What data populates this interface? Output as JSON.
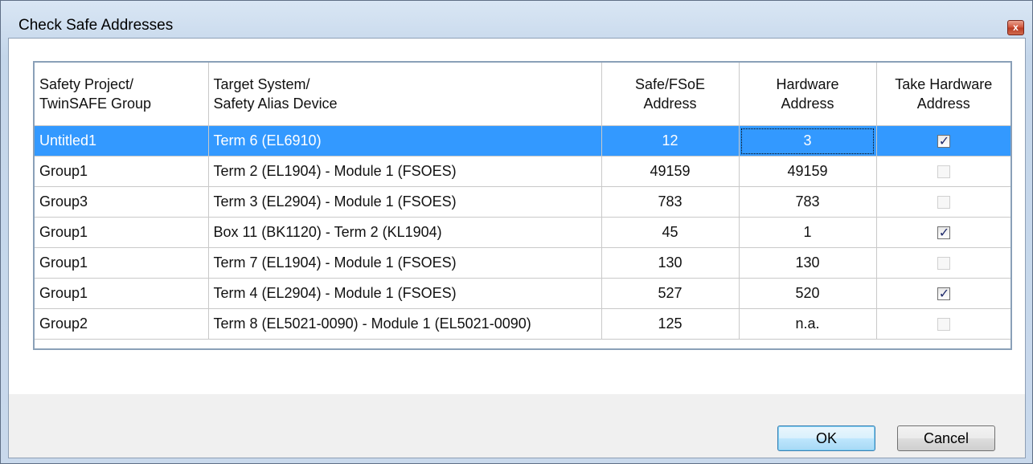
{
  "window": {
    "title": "Check Safe Addresses",
    "close_glyph": "x"
  },
  "grid": {
    "columns": [
      {
        "line1": "Safety Project/",
        "line2": "TwinSAFE Group"
      },
      {
        "line1": "Target System/",
        "line2": "Safety Alias Device"
      },
      {
        "line1": "Safe/FSoE",
        "line2": "Address"
      },
      {
        "line1": "Hardware",
        "line2": "Address"
      },
      {
        "line1": "Take Hardware",
        "line2": "Address"
      }
    ],
    "rows": [
      {
        "group": "Untitled1",
        "target": "Term 6 (EL6910)",
        "safe_address": "12",
        "hardware_address": "3",
        "take_hardware": true,
        "enabled": true,
        "selected": true
      },
      {
        "group": "Group1",
        "target": "Term 2 (EL1904) - Module 1 (FSOES)",
        "safe_address": "49159",
        "hardware_address": "49159",
        "take_hardware": false,
        "enabled": false,
        "selected": false
      },
      {
        "group": "Group3",
        "target": "Term 3 (EL2904) - Module 1 (FSOES)",
        "safe_address": "783",
        "hardware_address": "783",
        "take_hardware": false,
        "enabled": false,
        "selected": false
      },
      {
        "group": "Group1",
        "target": "Box 11 (BK1120) - Term 2 (KL1904)",
        "safe_address": "45",
        "hardware_address": "1",
        "take_hardware": true,
        "enabled": true,
        "selected": false
      },
      {
        "group": "Group1",
        "target": "Term 7 (EL1904) - Module 1 (FSOES)",
        "safe_address": "130",
        "hardware_address": "130",
        "take_hardware": false,
        "enabled": false,
        "selected": false
      },
      {
        "group": "Group1",
        "target": "Term 4 (EL2904) - Module 1 (FSOES)",
        "safe_address": "527",
        "hardware_address": "520",
        "take_hardware": true,
        "enabled": true,
        "selected": false
      },
      {
        "group": "Group2",
        "target": "Term 8 (EL5021-0090) - Module 1 (EL5021-0090)",
        "safe_address": "125",
        "hardware_address": "n.a.",
        "take_hardware": false,
        "enabled": false,
        "selected": false
      }
    ]
  },
  "buttons": {
    "ok": "OK",
    "cancel": "Cancel"
  },
  "colors": {
    "selection": "#3399ff",
    "default_button_border": "#3c7fb1",
    "close_button": "#c94a30"
  }
}
